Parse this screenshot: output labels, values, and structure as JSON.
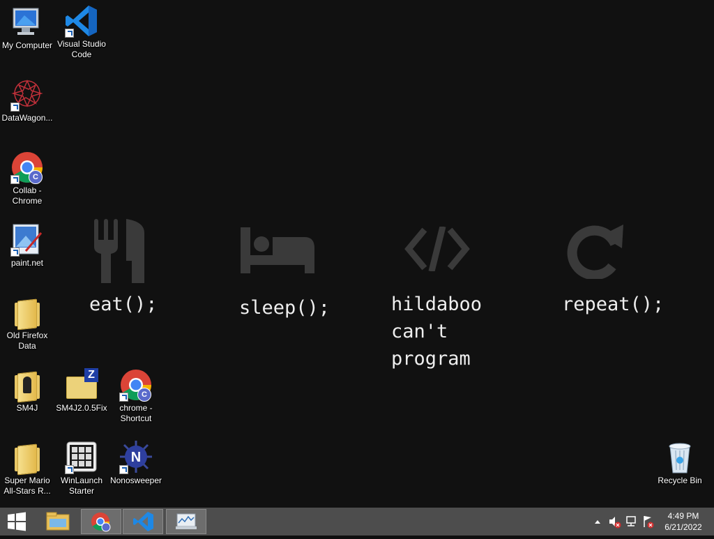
{
  "wallpaper": {
    "eat": "eat();",
    "sleep": "sleep();",
    "program": "hildaboo\ncan't\nprogram",
    "repeat": "repeat();",
    "icons": [
      "fork-knife-icon",
      "bed-icon",
      "code-icon",
      "refresh-icon"
    ],
    "icon_color": "#3a3a3a"
  },
  "desktop_icons": [
    {
      "label": "My Computer",
      "icon": "computer-icon"
    },
    {
      "label": "Visual Studio\nCode",
      "icon": "vscode-icon"
    },
    {
      "label": "DataWagon...",
      "icon": "datawagon-icon"
    },
    {
      "label": "Collab -\nChrome",
      "icon": "chrome-icon"
    },
    {
      "label": "paint.net",
      "icon": "paintnet-icon"
    },
    {
      "label": "Old Firefox\nData",
      "icon": "folder-icon"
    },
    {
      "label": "SM4J",
      "icon": "folder-icon"
    },
    {
      "label": "SM4J2.0.5Fix",
      "icon": "zip-folder-icon"
    },
    {
      "label": "chrome -\nShortcut",
      "icon": "chrome-icon"
    },
    {
      "label": "Super Mario\nAll-Stars R...",
      "icon": "folder-icon"
    },
    {
      "label": "WinLaunch\nStarter",
      "icon": "winlaunch-icon"
    },
    {
      "label": "Nonosweeper",
      "icon": "nonosweeper-icon"
    },
    {
      "label": "Recycle Bin",
      "icon": "recycle-bin-icon"
    }
  ],
  "taskbar": {
    "items": [
      "start-icon",
      "file-explorer-icon",
      "chrome-icon",
      "vscode-icon",
      "resource-monitor-icon"
    ],
    "clock_time": "4:49 PM",
    "clock_date": "6/21/2022",
    "tray_icons": [
      "show-hidden-icons-chevron",
      "volume-muted-icon",
      "network-error-icon",
      "action-center-flag-icon"
    ]
  },
  "colors": {
    "desktop_bg": "#111111",
    "taskbar_bg": "#4d4d4d",
    "chrome_badge": "#5a6acb",
    "vscode_blue": "#1e88e5"
  }
}
